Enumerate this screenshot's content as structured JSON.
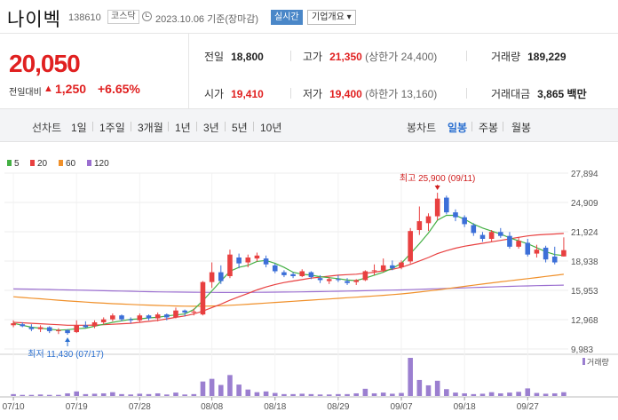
{
  "header": {
    "name": "나이벡",
    "code": "138610",
    "market": "코스닥",
    "date": "2023.10.06",
    "basis": "기준(장마감)",
    "realtime_label": "실시간",
    "overview_label": "기업개요"
  },
  "price": {
    "current": "20,050",
    "change_label": "전일대비",
    "change_value": "1,250",
    "change_percent": "+6.65%"
  },
  "stats": {
    "prev_label": "전일",
    "prev_value": "18,800",
    "open_label": "시가",
    "open_value": "19,410",
    "high_label": "고가",
    "high_value": "21,350",
    "upper_limit": "(상한가 24,400)",
    "low_label": "저가",
    "low_value": "19,400",
    "lower_limit": "(하한가 13,160)",
    "volume_label": "거래량",
    "volume_value": "189,229",
    "amount_label": "거래대금",
    "amount_value": "3,865",
    "amount_unit": "백만"
  },
  "toolbar": {
    "line_chart_label": "선차트",
    "periods": [
      "1일",
      "1주일",
      "3개월",
      "1년",
      "3년",
      "5년",
      "10년"
    ],
    "candle_chart_label": "봉차트",
    "candle_periods": [
      "일봉",
      "주봉",
      "월봉"
    ],
    "active_candle": "일봉"
  },
  "legend": [
    {
      "label": "5",
      "color": "#44b044"
    },
    {
      "label": "20",
      "color": "#e84040"
    },
    {
      "label": "60",
      "color": "#f0902a"
    },
    {
      "label": "120",
      "color": "#9b6fd0"
    }
  ],
  "chart_data": {
    "type": "candlestick",
    "y_ticks": [
      "27,894",
      "24,909",
      "21,924",
      "18,938",
      "15,953",
      "12,968",
      "9,983"
    ],
    "x_ticks": [
      "07/10",
      "07/19",
      "07/28",
      "08/08",
      "08/18",
      "08/29",
      "09/07",
      "09/18",
      "09/27"
    ],
    "ylim": [
      9983,
      27894
    ],
    "high_annotation": "최고 25,900 (09/11)",
    "low_annotation": "최저 11,430 (07/17)",
    "volume_label": "거래량",
    "colors": {
      "up": "#e84040",
      "down": "#3c6fd8",
      "volume": "#9b7fd0"
    },
    "candles": [
      {
        "o": 12400,
        "h": 12900,
        "l": 12200,
        "c": 12600
      },
      {
        "o": 12500,
        "h": 12700,
        "l": 12200,
        "c": 12300
      },
      {
        "o": 12200,
        "h": 12500,
        "l": 11800,
        "c": 12000
      },
      {
        "o": 12000,
        "h": 12400,
        "l": 11700,
        "c": 12200
      },
      {
        "o": 12200,
        "h": 12300,
        "l": 11600,
        "c": 11800
      },
      {
        "o": 11800,
        "h": 12100,
        "l": 11500,
        "c": 11900
      },
      {
        "o": 11900,
        "h": 12000,
        "l": 11430,
        "c": 11600
      },
      {
        "o": 11700,
        "h": 12900,
        "l": 11600,
        "c": 12400
      },
      {
        "o": 12400,
        "h": 12800,
        "l": 12100,
        "c": 12200
      },
      {
        "o": 12300,
        "h": 12900,
        "l": 12100,
        "c": 12700
      },
      {
        "o": 12700,
        "h": 13200,
        "l": 12500,
        "c": 13000
      },
      {
        "o": 13000,
        "h": 13600,
        "l": 12800,
        "c": 13400
      },
      {
        "o": 13400,
        "h": 13500,
        "l": 12800,
        "c": 13000
      },
      {
        "o": 13000,
        "h": 13200,
        "l": 12600,
        "c": 12900
      },
      {
        "o": 12900,
        "h": 13600,
        "l": 12700,
        "c": 13400
      },
      {
        "o": 13400,
        "h": 13500,
        "l": 12900,
        "c": 13100
      },
      {
        "o": 13100,
        "h": 13700,
        "l": 12800,
        "c": 13500
      },
      {
        "o": 13500,
        "h": 13600,
        "l": 12900,
        "c": 13200
      },
      {
        "o": 13200,
        "h": 14200,
        "l": 13100,
        "c": 13900
      },
      {
        "o": 13900,
        "h": 14000,
        "l": 13300,
        "c": 13700
      },
      {
        "o": 13700,
        "h": 14100,
        "l": 13400,
        "c": 13800
      },
      {
        "o": 13500,
        "h": 16900,
        "l": 13400,
        "c": 16800
      },
      {
        "o": 16800,
        "h": 18800,
        "l": 16200,
        "c": 17800
      },
      {
        "o": 17800,
        "h": 18500,
        "l": 16600,
        "c": 16900
      },
      {
        "o": 17400,
        "h": 20100,
        "l": 17200,
        "c": 19600
      },
      {
        "o": 19300,
        "h": 19700,
        "l": 18200,
        "c": 18700
      },
      {
        "o": 18800,
        "h": 19600,
        "l": 18300,
        "c": 19300
      },
      {
        "o": 19200,
        "h": 19800,
        "l": 18900,
        "c": 19500
      },
      {
        "o": 19200,
        "h": 19500,
        "l": 18300,
        "c": 18600
      },
      {
        "o": 18500,
        "h": 18700,
        "l": 17700,
        "c": 17900
      },
      {
        "o": 17800,
        "h": 18000,
        "l": 17300,
        "c": 17500
      },
      {
        "o": 17600,
        "h": 17800,
        "l": 17200,
        "c": 17400
      },
      {
        "o": 17400,
        "h": 18100,
        "l": 17300,
        "c": 17900
      },
      {
        "o": 17800,
        "h": 17900,
        "l": 17100,
        "c": 17300
      },
      {
        "o": 17200,
        "h": 17500,
        "l": 16700,
        "c": 17000
      },
      {
        "o": 16900,
        "h": 17300,
        "l": 16600,
        "c": 17100
      },
      {
        "o": 17100,
        "h": 17500,
        "l": 16800,
        "c": 17000
      },
      {
        "o": 16900,
        "h": 17200,
        "l": 16500,
        "c": 16700
      },
      {
        "o": 16800,
        "h": 17100,
        "l": 16500,
        "c": 17000
      },
      {
        "o": 17000,
        "h": 18000,
        "l": 16900,
        "c": 17900
      },
      {
        "o": 17900,
        "h": 18600,
        "l": 17500,
        "c": 18000
      },
      {
        "o": 18000,
        "h": 19200,
        "l": 17800,
        "c": 18500
      },
      {
        "o": 18500,
        "h": 19000,
        "l": 18000,
        "c": 18200
      },
      {
        "o": 18300,
        "h": 19000,
        "l": 18100,
        "c": 18800
      },
      {
        "o": 18900,
        "h": 22300,
        "l": 18700,
        "c": 22000
      },
      {
        "o": 22100,
        "h": 24500,
        "l": 21600,
        "c": 23000
      },
      {
        "o": 22800,
        "h": 23800,
        "l": 22000,
        "c": 23500
      },
      {
        "o": 23500,
        "h": 25900,
        "l": 23100,
        "c": 25300
      },
      {
        "o": 25400,
        "h": 25600,
        "l": 23700,
        "c": 23900
      },
      {
        "o": 23900,
        "h": 24200,
        "l": 23000,
        "c": 23400
      },
      {
        "o": 23400,
        "h": 23600,
        "l": 22400,
        "c": 22700
      },
      {
        "o": 22600,
        "h": 22800,
        "l": 21500,
        "c": 21800
      },
      {
        "o": 21600,
        "h": 21900,
        "l": 20900,
        "c": 21200
      },
      {
        "o": 21200,
        "h": 22100,
        "l": 20900,
        "c": 21900
      },
      {
        "o": 21900,
        "h": 22300,
        "l": 21300,
        "c": 21500
      },
      {
        "o": 21500,
        "h": 21900,
        "l": 20200,
        "c": 20400
      },
      {
        "o": 20400,
        "h": 21400,
        "l": 20200,
        "c": 21000
      },
      {
        "o": 20800,
        "h": 21200,
        "l": 19400,
        "c": 19600
      },
      {
        "o": 19700,
        "h": 20600,
        "l": 19300,
        "c": 20100
      },
      {
        "o": 20300,
        "h": 20500,
        "l": 18800,
        "c": 19100
      },
      {
        "o": 19400,
        "h": 20400,
        "l": 18600,
        "c": 18800
      },
      {
        "o": 19410,
        "h": 21350,
        "l": 19400,
        "c": 20050
      }
    ],
    "volume": [
      0.05,
      0.03,
      0.03,
      0.04,
      0.03,
      0.03,
      0.07,
      0.12,
      0.05,
      0.06,
      0.07,
      0.1,
      0.05,
      0.04,
      0.06,
      0.05,
      0.07,
      0.04,
      0.09,
      0.04,
      0.05,
      0.38,
      0.45,
      0.29,
      0.55,
      0.3,
      0.17,
      0.1,
      0.12,
      0.08,
      0.05,
      0.05,
      0.06,
      0.05,
      0.04,
      0.04,
      0.05,
      0.05,
      0.07,
      0.19,
      0.07,
      0.09,
      0.06,
      0.08,
      1.0,
      0.42,
      0.28,
      0.4,
      0.18,
      0.09,
      0.07,
      0.05,
      0.06,
      0.1,
      0.07,
      0.09,
      0.11,
      0.2,
      0.08,
      0.06,
      0.07,
      0.1
    ],
    "ma5": [
      12600,
      12400,
      12200,
      12100,
      12000,
      11900,
      11950,
      12050,
      12100,
      12300,
      12500,
      12700,
      12850,
      13000,
      13050,
      13150,
      13200,
      13350,
      13450,
      13550,
      14000,
      14900,
      15900,
      16900,
      17900,
      18300,
      18500,
      18900,
      19000,
      18700,
      18300,
      17800,
      17600,
      17500,
      17350,
      17250,
      17150,
      17000,
      16950,
      17200,
      17500,
      17800,
      18200,
      18700,
      19700,
      20700,
      21800,
      23100,
      23600,
      23600,
      23200,
      22700,
      22300,
      22000,
      21700,
      21300,
      21000,
      20700,
      20300,
      19900,
      19600,
      19500
    ],
    "ma20": [
      12700,
      12650,
      12600,
      12550,
      12500,
      12450,
      12400,
      12400,
      12400,
      12420,
      12450,
      12500,
      12550,
      12600,
      12700,
      12800,
      12900,
      13050,
      13200,
      13350,
      13550,
      13850,
      14200,
      14550,
      14950,
      15300,
      15650,
      16000,
      16300,
      16550,
      16750,
      16900,
      17050,
      17200,
      17300,
      17400,
      17500,
      17550,
      17600,
      17700,
      17800,
      17950,
      18100,
      18300,
      18600,
      18950,
      19300,
      19700,
      20000,
      20250,
      20450,
      20600,
      20750,
      20900,
      21050,
      21200,
      21350,
      21500,
      21600,
      21650,
      21700,
      21750
    ],
    "ma60": [
      15300,
      15230,
      15160,
      15090,
      15020,
      14950,
      14880,
      14820,
      14760,
      14700,
      14650,
      14600,
      14560,
      14520,
      14480,
      14450,
      14420,
      14390,
      14360,
      14340,
      14330,
      14340,
      14360,
      14390,
      14430,
      14480,
      14540,
      14600,
      14660,
      14720,
      14780,
      14840,
      14900,
      14960,
      15020,
      15080,
      15140,
      15200,
      15260,
      15320,
      15380,
      15450,
      15520,
      15590,
      15680,
      15780,
      15890,
      16000,
      16120,
      16240,
      16360,
      16480,
      16600,
      16710,
      16820,
      16930,
      17040,
      17150,
      17260,
      17370,
      17480,
      17590
    ],
    "ma120": [
      16100,
      16090,
      16080,
      16060,
      16040,
      16020,
      16000,
      15980,
      15960,
      15940,
      15920,
      15900,
      15880,
      15860,
      15840,
      15820,
      15800,
      15790,
      15780,
      15770,
      15760,
      15750,
      15745,
      15740,
      15740,
      15740,
      15745,
      15750,
      15760,
      15770,
      15780,
      15790,
      15800,
      15815,
      15830,
      15845,
      15860,
      15880,
      15900,
      15920,
      15940,
      15960,
      15980,
      16000,
      16030,
      16060,
      16090,
      16120,
      16150,
      16180,
      16210,
      16240,
      16270,
      16300,
      16330,
      16360,
      16390,
      16410,
      16430,
      16450,
      16470,
      16490
    ]
  }
}
